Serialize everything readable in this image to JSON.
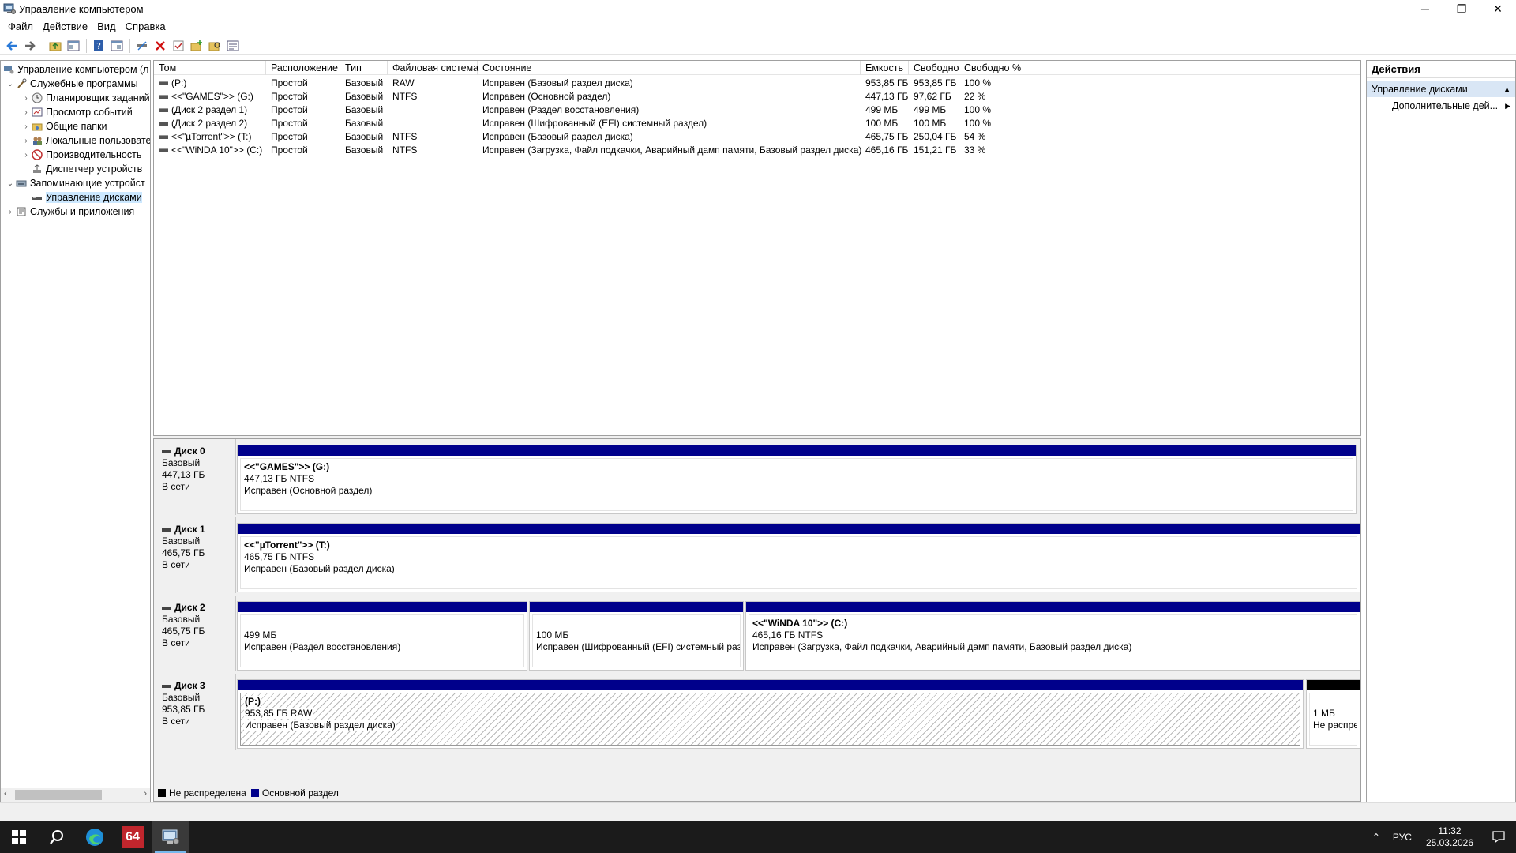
{
  "window": {
    "title": "Управление компьютером",
    "minimize": "─",
    "maximize": "❐",
    "close": "✕"
  },
  "menu": [
    "Файл",
    "Действие",
    "Вид",
    "Справка"
  ],
  "tree": {
    "items": [
      {
        "label": "Управление компьютером (л",
        "level": 0,
        "expander": ""
      },
      {
        "label": "Служебные программы",
        "level": 1,
        "expander": "v"
      },
      {
        "label": "Планировщик заданий",
        "level": 2,
        "expander": ">"
      },
      {
        "label": "Просмотр событий",
        "level": 2,
        "expander": ">"
      },
      {
        "label": "Общие папки",
        "level": 2,
        "expander": ">"
      },
      {
        "label": "Локальные пользовате",
        "level": 2,
        "expander": ">"
      },
      {
        "label": "Производительность",
        "level": 2,
        "expander": ">"
      },
      {
        "label": "Диспетчер устройств",
        "level": 2,
        "expander": ""
      },
      {
        "label": "Запоминающие устройст",
        "level": 1,
        "expander": "v"
      },
      {
        "label": "Управление дисками",
        "level": 2,
        "expander": ""
      },
      {
        "label": "Службы и приложения",
        "level": 1,
        "expander": ">"
      }
    ]
  },
  "volumes": {
    "columns": [
      "Том",
      "Расположение",
      "Тип",
      "Файловая система",
      "Состояние",
      "Емкость",
      "Свободно",
      "Свободно %"
    ],
    "rows": [
      [
        "(P:)",
        "Простой",
        "Базовый",
        "RAW",
        "Исправен (Базовый раздел диска)",
        "953,85 ГБ",
        "953,85 ГБ",
        "100 %"
      ],
      [
        "<<\"GAMES\">> (G:)",
        "Простой",
        "Базовый",
        "NTFS",
        "Исправен (Основной раздел)",
        "447,13 ГБ",
        "97,62 ГБ",
        "22 %"
      ],
      [
        "(Диск 2 раздел 1)",
        "Простой",
        "Базовый",
        "",
        "Исправен (Раздел восстановления)",
        "499 МБ",
        "499 МБ",
        "100 %"
      ],
      [
        "(Диск 2 раздел 2)",
        "Простой",
        "Базовый",
        "",
        "Исправен (Шифрованный (EFI) системный раздел)",
        "100 МБ",
        "100 МБ",
        "100 %"
      ],
      [
        "<<\"µTorrent\">> (T:)",
        "Простой",
        "Базовый",
        "NTFS",
        "Исправен (Базовый раздел диска)",
        "465,75 ГБ",
        "250,04 ГБ",
        "54 %"
      ],
      [
        "<<\"WiNDA 10\">> (C:)",
        "Простой",
        "Базовый",
        "NTFS",
        "Исправен (Загрузка, Файл подкачки, Аварийный дамп памяти, Базовый раздел диска)",
        "465,16 ГБ",
        "151,21 ГБ",
        "33 %"
      ]
    ]
  },
  "disks": [
    {
      "name": "Диск 0",
      "type": "Базовый",
      "size": "447,13 ГБ",
      "status": "В сети",
      "partitions": [
        {
          "title": "<<\"GAMES\">>  (G:)",
          "size": "447,13 ГБ NTFS",
          "state": "Исправен (Основной раздел)",
          "kind": "primary"
        }
      ]
    },
    {
      "name": "Диск 1",
      "type": "Базовый",
      "size": "465,75 ГБ",
      "status": "В сети",
      "partitions": [
        {
          "title": "<<\"µTorrent\">>  (T:)",
          "size": "465,75 ГБ NTFS",
          "state": "Исправен (Базовый раздел диска)",
          "kind": "primary"
        }
      ]
    },
    {
      "name": "Диск 2",
      "type": "Базовый",
      "size": "465,75 ГБ",
      "status": "В сети",
      "partitions": [
        {
          "title": "",
          "size": "499 МБ",
          "state": "Исправен (Раздел восстановления)",
          "kind": "primary"
        },
        {
          "title": "",
          "size": "100 МБ",
          "state": "Исправен (Шифрованный (EFI) системный раз",
          "kind": "primary"
        },
        {
          "title": "<<\"WiNDA 10\">>  (C:)",
          "size": "465,16 ГБ NTFS",
          "state": "Исправен (Загрузка, Файл подкачки, Аварийный дамп памяти, Базовый раздел диска)",
          "kind": "primary"
        }
      ]
    },
    {
      "name": "Диск 3",
      "type": "Базовый",
      "size": "953,85 ГБ",
      "status": "В сети",
      "partitions": [
        {
          "title": "(P:)",
          "size": "953,85 ГБ RAW",
          "state": "Исправен (Базовый раздел диска)",
          "kind": "primary-selected"
        },
        {
          "title": "",
          "size": "1 МБ",
          "state": "Не распре",
          "kind": "unallocated"
        }
      ]
    }
  ],
  "legend": [
    {
      "label": "Не распределена",
      "color": "#000000"
    },
    {
      "label": "Основной раздел",
      "color": "#00008b"
    }
  ],
  "actions": {
    "title": "Действия",
    "section": "Управление дисками",
    "more": "Дополнительные дей..."
  },
  "taskbar": {
    "aida_label": "64",
    "lang": "РУС",
    "time": "11:32",
    "date": "25.03.2026"
  },
  "colors": {
    "primary_partition": "#00008b",
    "unallocated": "#000000",
    "selection": "#cce8ff"
  }
}
